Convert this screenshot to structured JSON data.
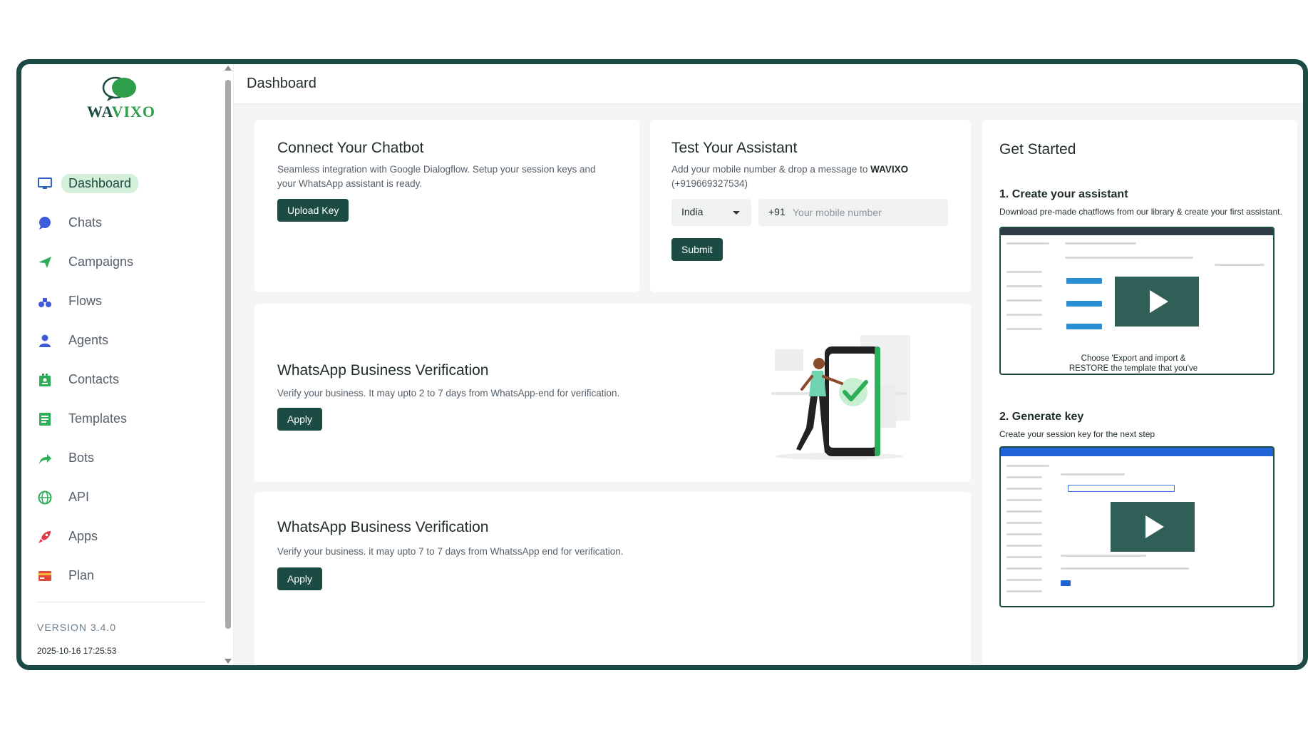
{
  "brand": {
    "name_a": "WA",
    "name_b": "VIXO",
    "colors": {
      "primary": "#1c4b43",
      "accent": "#2f9e4a",
      "active_bg": "#d4f0d9"
    }
  },
  "sidebar": {
    "items": [
      {
        "label": "Dashboard",
        "icon": "monitor-icon",
        "active": true
      },
      {
        "label": "Chats",
        "icon": "chat-bubble-icon"
      },
      {
        "label": "Campaigns",
        "icon": "paper-plane-icon"
      },
      {
        "label": "Flows",
        "icon": "flow-icon"
      },
      {
        "label": "Agents",
        "icon": "person-icon"
      },
      {
        "label": "Contacts",
        "icon": "contacts-icon"
      },
      {
        "label": "Templates",
        "icon": "document-icon"
      },
      {
        "label": "Bots",
        "icon": "share-arrow-icon"
      },
      {
        "label": "API",
        "icon": "globe-icon"
      },
      {
        "label": "Apps",
        "icon": "rocket-icon"
      },
      {
        "label": "Plan",
        "icon": "credit-card-icon"
      }
    ],
    "version": "VERSION 3.4.0",
    "timestamp": "2025-10-16 17:25:53"
  },
  "header": {
    "title": "Dashboard"
  },
  "connect_card": {
    "title": "Connect Your Chatbot",
    "description": "Seamless integration with Google Dialogflow. Setup your session keys and your WhatsApp assistant is ready.",
    "button": "Upload Key"
  },
  "test_card": {
    "title": "Test Your Assistant",
    "description_pre": "Add your mobile number & drop a message to ",
    "description_brand": "WAVIXO",
    "description_number": "(+919669327534)",
    "country": "India",
    "country_code": "+91",
    "phone_placeholder": "Your mobile number",
    "button": "Submit"
  },
  "verify_card_1": {
    "title": "WhatsApp Business Verification",
    "description": "Verify your business. It may upto 2 to 7 days from WhatsApp-end for verification.",
    "button": "Apply"
  },
  "verify_card_2": {
    "title": "WhatsApp Business Verification",
    "description": "Verify your business. it may upto 7 to 7 days from WhatssApp end for verification.",
    "button": "Apply"
  },
  "get_started": {
    "title": "Get Started",
    "step1": {
      "title": "1. Create your assistant",
      "description": "Download pre-made chatflows from our library & create your first assistant.",
      "caption": "Choose 'Export and import & RESTORE the template that you've downloaded."
    },
    "step2": {
      "title": "2. Generate key",
      "description": "Create your session key for the next step"
    }
  }
}
